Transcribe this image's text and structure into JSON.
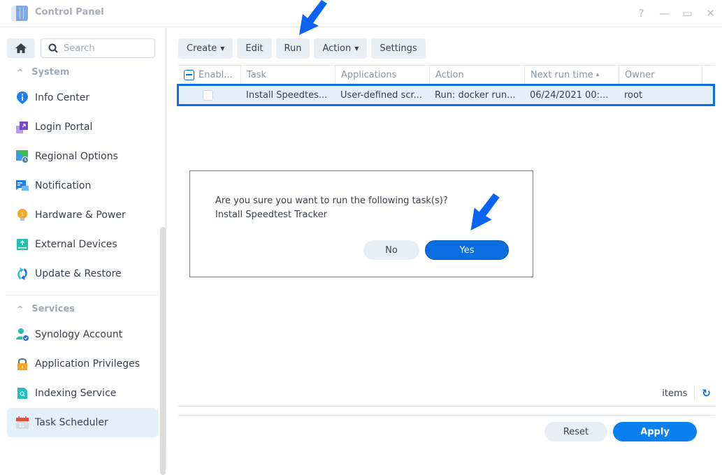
{
  "window": {
    "title": "Control Panel",
    "controls": [
      {
        "name": "help-icon",
        "glyph": "?"
      },
      {
        "name": "minimize-icon",
        "glyph": "—"
      },
      {
        "name": "maximize-icon",
        "glyph": "▭"
      },
      {
        "name": "close-icon",
        "glyph": "✕"
      }
    ]
  },
  "sidebar": {
    "search_placeholder": "Search",
    "sections": [
      {
        "label": "System",
        "items": [
          {
            "label": "Info Center",
            "icon": "info-icon"
          },
          {
            "label": "Login Portal",
            "icon": "login-portal-icon"
          },
          {
            "label": "Regional Options",
            "icon": "regional-options-icon"
          },
          {
            "label": "Notification",
            "icon": "notification-icon"
          },
          {
            "label": "Hardware & Power",
            "icon": "hardware-power-icon"
          },
          {
            "label": "External Devices",
            "icon": "external-devices-icon"
          },
          {
            "label": "Update & Restore",
            "icon": "update-restore-icon"
          }
        ]
      },
      {
        "label": "Services",
        "items": [
          {
            "label": "Synology Account",
            "icon": "synology-account-icon"
          },
          {
            "label": "Application Privileges",
            "icon": "application-privileges-icon"
          },
          {
            "label": "Indexing Service",
            "icon": "indexing-service-icon"
          },
          {
            "label": "Task Scheduler",
            "icon": "task-scheduler-icon",
            "active": true
          }
        ]
      }
    ]
  },
  "toolbar": {
    "create": "Create",
    "edit": "Edit",
    "run": "Run",
    "action": "Action",
    "settings": "Settings"
  },
  "grid": {
    "columns": [
      "Enabl...",
      "Task",
      "Applications",
      "Action",
      "Next run time",
      "Owner"
    ],
    "sort_indicator": "▴",
    "rows": [
      {
        "enabled": false,
        "task": "Install Speedtes...",
        "applications": "User-defined scr...",
        "action": "Run: docker run...",
        "next_run_time": "06/24/2021 00:...",
        "owner": "root"
      }
    ]
  },
  "dialog": {
    "message_line1": "Are you sure you want to run the following task(s)?",
    "message_line2": "Install Speedtest Tracker",
    "no_label": "No",
    "yes_label": "Yes"
  },
  "footer": {
    "items_label": "items",
    "reset_label": "Reset",
    "apply_label": "Apply"
  },
  "colors": {
    "accent": "#0a6ee0",
    "selection": "#e4effc",
    "annotation_arrow": "#0a63f5"
  }
}
